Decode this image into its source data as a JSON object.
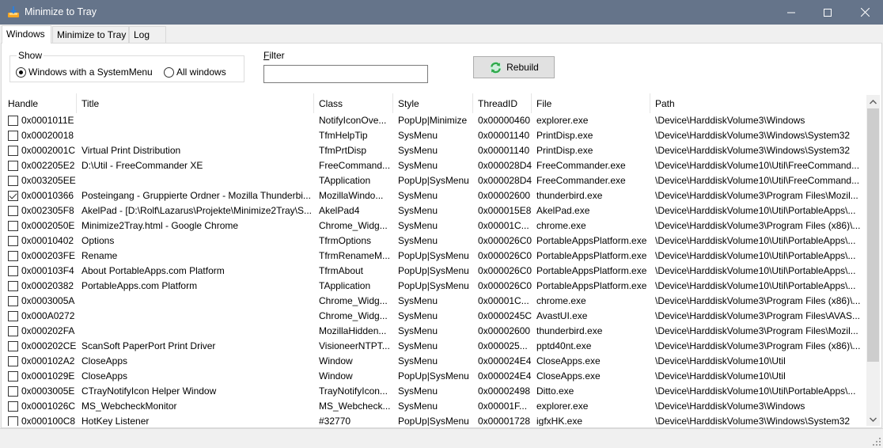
{
  "window": {
    "title": "Minimize to Tray",
    "icons": {
      "app": "download-tray-icon",
      "minimize": "minimize-icon",
      "maximize": "maximize-icon",
      "close": "close-icon"
    }
  },
  "tabs": [
    {
      "label": "Windows",
      "active": true
    },
    {
      "label": "Minimize to Tray",
      "active": false
    },
    {
      "label": "Log",
      "active": false
    }
  ],
  "show": {
    "legend": "Show",
    "options": [
      {
        "label": "Windows with a SystemMenu",
        "selected": true
      },
      {
        "label": "All windows",
        "selected": false
      }
    ]
  },
  "filter": {
    "label_accel": "F",
    "label_rest": "ilter",
    "value": "",
    "placeholder": ""
  },
  "rebuild": {
    "label": "Rebuild",
    "icon": "refresh-icon"
  },
  "table": {
    "columns": [
      "Handle",
      "Title",
      "Class",
      "Style",
      "ThreadID",
      "File",
      "Path"
    ],
    "rows": [
      {
        "checked": false,
        "handle": "0x0001011E",
        "title": "",
        "class": "NotifyIconOve...",
        "style": "PopUp|Minimize",
        "thread": "0x00000460",
        "file": "explorer.exe",
        "path": "\\Device\\HarddiskVolume3\\Windows"
      },
      {
        "checked": false,
        "handle": "0x00020018",
        "title": "",
        "class": "TfmHelpTip",
        "style": "SysMenu",
        "thread": "0x00001140",
        "file": "PrintDisp.exe",
        "path": "\\Device\\HarddiskVolume3\\Windows\\System32"
      },
      {
        "checked": false,
        "handle": "0x0002001C",
        "title": "Virtual Print Distribution",
        "class": "TfmPrtDisp",
        "style": "SysMenu",
        "thread": "0x00001140",
        "file": "PrintDisp.exe",
        "path": "\\Device\\HarddiskVolume3\\Windows\\System32"
      },
      {
        "checked": false,
        "handle": "0x002205E2",
        "title": "D:\\Util - FreeCommander XE",
        "class": "FreeCommand...",
        "style": "SysMenu",
        "thread": "0x000028D4",
        "file": "FreeCommander.exe",
        "path": "\\Device\\HarddiskVolume10\\Util\\FreeCommand..."
      },
      {
        "checked": false,
        "handle": "0x003205EE",
        "title": "",
        "class": "TApplication",
        "style": "PopUp|SysMenu",
        "thread": "0x000028D4",
        "file": "FreeCommander.exe",
        "path": "\\Device\\HarddiskVolume10\\Util\\FreeCommand..."
      },
      {
        "checked": true,
        "handle": "0x00010366",
        "title": "Posteingang - Gruppierte Ordner - Mozilla Thunderbi...",
        "class": "MozillaWindo...",
        "style": "SysMenu",
        "thread": "0x00002600",
        "file": "thunderbird.exe",
        "path": "\\Device\\HarddiskVolume3\\Program Files\\Mozil..."
      },
      {
        "checked": false,
        "handle": "0x002305F8",
        "title": "AkelPad - [D:\\Rolf\\Lazarus\\Projekte\\Minimize2Tray\\S...",
        "class": "AkelPad4",
        "style": "SysMenu",
        "thread": "0x000015E8",
        "file": "AkelPad.exe",
        "path": "\\Device\\HarddiskVolume10\\Util\\PortableApps\\..."
      },
      {
        "checked": false,
        "handle": "0x0002050E",
        "title": "Minimize2Tray.html - Google Chrome",
        "class": "Chrome_Widg...",
        "style": "SysMenu",
        "thread": "0x00001C...",
        "file": "chrome.exe",
        "path": "\\Device\\HarddiskVolume3\\Program Files (x86)\\..."
      },
      {
        "checked": false,
        "handle": "0x00010402",
        "title": "Options",
        "class": "TfrmOptions",
        "style": "SysMenu",
        "thread": "0x000026C0",
        "file": "PortableAppsPlatform.exe",
        "path": "\\Device\\HarddiskVolume10\\Util\\PortableApps\\..."
      },
      {
        "checked": false,
        "handle": "0x000203FE",
        "title": "Rename",
        "class": "TfrmRenameM...",
        "style": "PopUp|SysMenu",
        "thread": "0x000026C0",
        "file": "PortableAppsPlatform.exe",
        "path": "\\Device\\HarddiskVolume10\\Util\\PortableApps\\..."
      },
      {
        "checked": false,
        "handle": "0x000103F4",
        "title": "About PortableApps.com Platform",
        "class": "TfrmAbout",
        "style": "PopUp|SysMenu",
        "thread": "0x000026C0",
        "file": "PortableAppsPlatform.exe",
        "path": "\\Device\\HarddiskVolume10\\Util\\PortableApps\\..."
      },
      {
        "checked": false,
        "handle": "0x00020382",
        "title": "PortableApps.com Platform",
        "class": "TApplication",
        "style": "PopUp|SysMenu",
        "thread": "0x000026C0",
        "file": "PortableAppsPlatform.exe",
        "path": "\\Device\\HarddiskVolume10\\Util\\PortableApps\\..."
      },
      {
        "checked": false,
        "handle": "0x0003005A",
        "title": "",
        "class": "Chrome_Widg...",
        "style": "SysMenu",
        "thread": "0x00001C...",
        "file": "chrome.exe",
        "path": "\\Device\\HarddiskVolume3\\Program Files (x86)\\..."
      },
      {
        "checked": false,
        "handle": "0x000A0272",
        "title": "",
        "class": "Chrome_Widg...",
        "style": "SysMenu",
        "thread": "0x0000245C",
        "file": "AvastUI.exe",
        "path": "\\Device\\HarddiskVolume3\\Program Files\\AVAS..."
      },
      {
        "checked": false,
        "handle": "0x000202FA",
        "title": "",
        "class": "MozillaHidden...",
        "style": "SysMenu",
        "thread": "0x00002600",
        "file": "thunderbird.exe",
        "path": "\\Device\\HarddiskVolume3\\Program Files\\Mozil..."
      },
      {
        "checked": false,
        "handle": "0x000202CE",
        "title": "ScanSoft PaperPort Print Driver",
        "class": "VisioneerNTPT...",
        "style": "SysMenu",
        "thread": "0x000025...",
        "file": "pptd40nt.exe",
        "path": "\\Device\\HarddiskVolume3\\Program Files (x86)\\..."
      },
      {
        "checked": false,
        "handle": "0x000102A2",
        "title": "CloseApps",
        "class": "Window",
        "style": "SysMenu",
        "thread": "0x000024E4",
        "file": "CloseApps.exe",
        "path": "\\Device\\HarddiskVolume10\\Util"
      },
      {
        "checked": false,
        "handle": "0x0001029E",
        "title": "CloseApps",
        "class": "Window",
        "style": "PopUp|SysMenu",
        "thread": "0x000024E4",
        "file": "CloseApps.exe",
        "path": "\\Device\\HarddiskVolume10\\Util"
      },
      {
        "checked": false,
        "handle": "0x0003005E",
        "title": "CTrayNotifyIcon Helper Window",
        "class": "TrayNotifyIcon...",
        "style": "SysMenu",
        "thread": "0x00002498",
        "file": "Ditto.exe",
        "path": "\\Device\\HarddiskVolume10\\Util\\PortableApps\\..."
      },
      {
        "checked": false,
        "handle": "0x0001026C",
        "title": "MS_WebcheckMonitor",
        "class": "MS_Webcheck...",
        "style": "SysMenu",
        "thread": "0x00001F...",
        "file": "explorer.exe",
        "path": "\\Device\\HarddiskVolume3\\Windows"
      },
      {
        "checked": false,
        "handle": "0x000100C8",
        "title": "HotKey Listener",
        "class": "#32770",
        "style": "PopUp|SysMenu",
        "thread": "0x00001728",
        "file": "igfxHK.exe",
        "path": "\\Device\\HarddiskVolume3\\Windows\\System32"
      }
    ]
  },
  "scrollbar": {
    "icons": {
      "up": "chevron-up-icon",
      "down": "chevron-down-icon"
    }
  },
  "colors": {
    "titlebar": "#65748a",
    "refresh_green": "#2ea84a"
  }
}
